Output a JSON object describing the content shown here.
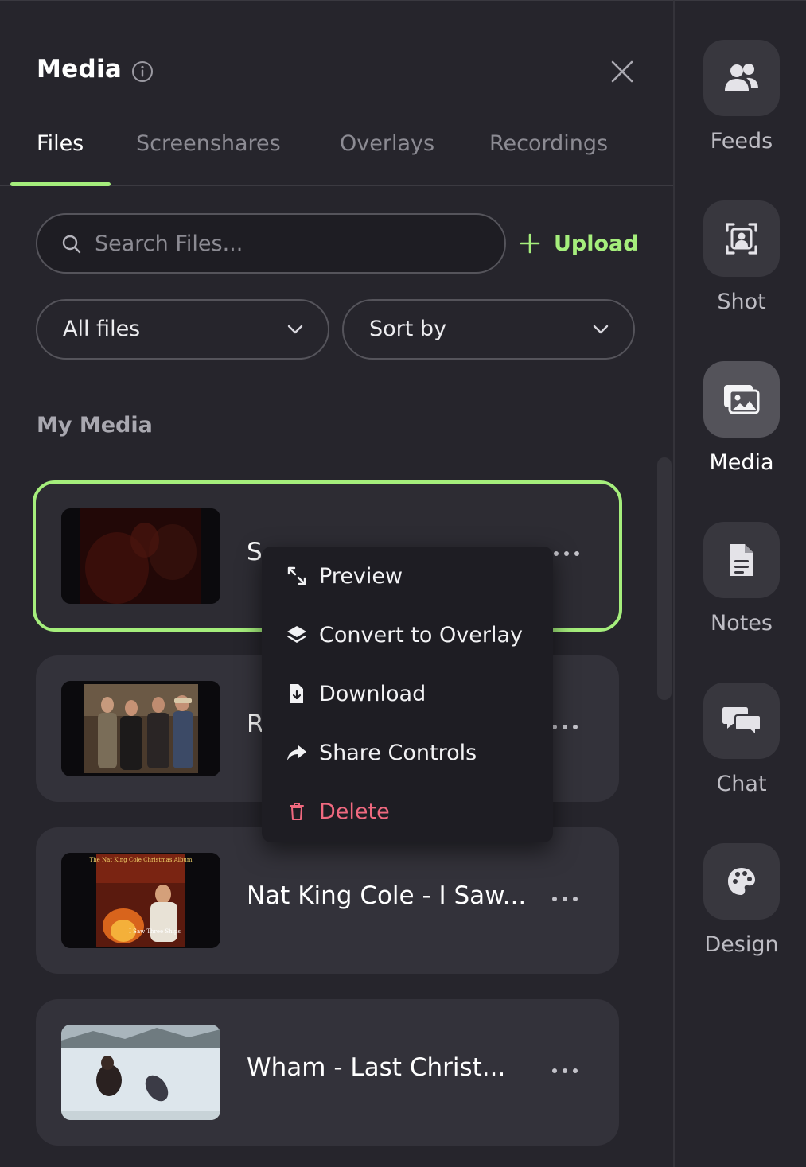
{
  "panel": {
    "title": "Media",
    "tabs": [
      "Files",
      "Screenshares",
      "Overlays",
      "Recordings"
    ],
    "active_tab": "Files",
    "search_placeholder": "Search Files...",
    "upload_label": "Upload",
    "filter_label": "All files",
    "sort_label": "Sort by",
    "section_title": "My Media",
    "accent_color": "#a5ee7c",
    "danger_color": "#f0697f"
  },
  "media": [
    {
      "title": "S",
      "selected": true
    },
    {
      "title": "R",
      "selected": false
    },
    {
      "title": "Nat King Cole - I Saw...",
      "selected": false
    },
    {
      "title": "Wham - Last Christ...",
      "selected": false
    }
  ],
  "context_menu": {
    "items": [
      {
        "label": "Preview",
        "icon": "expand-icon"
      },
      {
        "label": "Convert to Overlay",
        "icon": "layers-icon"
      },
      {
        "label": "Download",
        "icon": "file-download-icon"
      },
      {
        "label": "Share Controls",
        "icon": "share-icon"
      },
      {
        "label": "Delete",
        "icon": "trash-icon",
        "danger": true
      }
    ]
  },
  "thumb_text": {
    "album_header": "The Nat King Cole Christmas Album",
    "album_caption": "I Saw Three Ships"
  },
  "rail": {
    "items": [
      {
        "label": "Feeds",
        "icon": "users-icon"
      },
      {
        "label": "Shot",
        "icon": "portrait-icon"
      },
      {
        "label": "Media",
        "icon": "images-icon",
        "active": true
      },
      {
        "label": "Notes",
        "icon": "document-icon"
      },
      {
        "label": "Chat",
        "icon": "chat-icon"
      },
      {
        "label": "Design",
        "icon": "palette-icon"
      }
    ]
  }
}
